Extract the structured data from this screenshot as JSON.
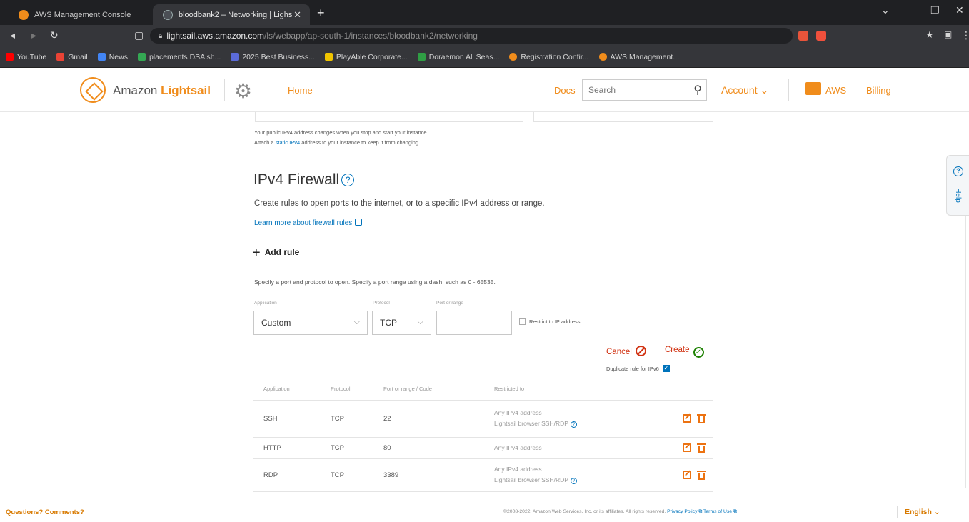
{
  "browser": {
    "tabs": [
      {
        "title": "AWS Management Console",
        "active": false
      },
      {
        "title": "bloodbank2 – Networking | Lighs",
        "active": true
      }
    ],
    "new_tab": "+",
    "url_host": "lightsail.aws.amazon.com",
    "url_path": "/ls/webapp/ap-south-1/instances/bloodbank2/networking",
    "bookmarks": [
      {
        "label": "YouTube",
        "color": "#ff0000"
      },
      {
        "label": "Gmail",
        "color": "#ea4335"
      },
      {
        "label": "News",
        "color": "#4285f4"
      },
      {
        "label": "placements DSA sh...",
        "color": "#34a853"
      },
      {
        "label": "2025 Best Business...",
        "color": "#5b6bd8"
      },
      {
        "label": "PlayAble Corporate...",
        "color": "#f0c400"
      },
      {
        "label": "Doraemon All Seas...",
        "color": "#2f9e44"
      },
      {
        "label": "Registration Confir...",
        "color": "#f08c1b"
      },
      {
        "label": "AWS Management...",
        "color": "#f08c1b"
      }
    ]
  },
  "header": {
    "brand_prefix": "Amazon ",
    "brand_name": "Lightsail",
    "home": "Home",
    "docs": "Docs",
    "search_placeholder": "Search",
    "account": "Account ⌄",
    "aws": "AWS",
    "billing": "Billing"
  },
  "ipv4_note": {
    "line1": "Your public IPv4 address changes when you stop and start your instance.",
    "line2_pre": "Attach a ",
    "line2_link": "static IPv4",
    "line2_post": " address to your instance to keep it from changing."
  },
  "firewall": {
    "title": "IPv4 Firewall",
    "help": "?",
    "description": "Create rules to open ports to the internet, or to a specific IPv4 address or range.",
    "learn_more": "Learn more about firewall rules",
    "add_rule": "Add rule",
    "spec_text": "Specify a port and protocol to open. Specify a port range using a dash, such as 0 - 65535.",
    "form": {
      "application_label": "Application",
      "protocol_label": "Protocol",
      "port_label": "Port or range",
      "application_value": "Custom",
      "protocol_value": "TCP",
      "port_value": "",
      "restrict_label": "Restrict to IP address",
      "cancel": "Cancel",
      "create": "Create",
      "duplicate_label": "Duplicate rule for IPv6"
    },
    "table": {
      "headers": [
        "Application",
        "Protocol",
        "Port or range / Code",
        "Restricted to"
      ],
      "rows": [
        {
          "application": "SSH",
          "protocol": "TCP",
          "port": "22",
          "restricted": "Any IPv4 address",
          "extra": "Lightsail browser SSH/RDP"
        },
        {
          "application": "HTTP",
          "protocol": "TCP",
          "port": "80",
          "restricted": "Any IPv4 address",
          "extra": ""
        },
        {
          "application": "RDP",
          "protocol": "TCP",
          "port": "3389",
          "restricted": "Any IPv4 address",
          "extra": "Lightsail browser SSH/RDP"
        }
      ]
    }
  },
  "help_tab": "Help",
  "footer": {
    "questions": "Questions? Comments?",
    "copyright": "©2008-2022, Amazon Web Services, Inc. or its affiliates. All rights reserved.",
    "privacy": "Privacy Policy",
    "terms": "Terms of Use",
    "language": "English ⌄"
  }
}
